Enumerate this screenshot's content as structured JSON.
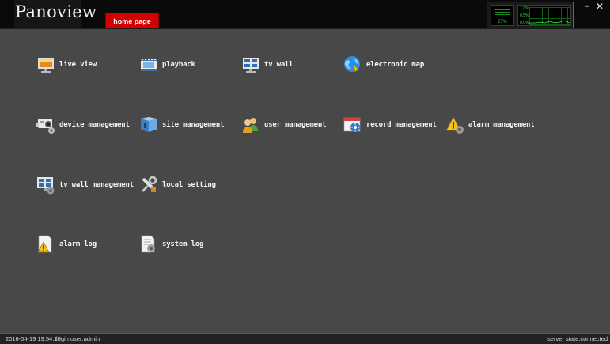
{
  "app": {
    "logo": "Panoview",
    "tab": "home page"
  },
  "monitor": {
    "cpu_text": "27%",
    "scale": [
      "1.0%",
      "0.5%",
      "0.0%"
    ]
  },
  "window": {
    "minimize": "–",
    "close": "✕"
  },
  "menu": [
    {
      "label": "live view",
      "icon": "live-view-icon"
    },
    {
      "label": "playback",
      "icon": "playback-icon"
    },
    {
      "label": "tv wall",
      "icon": "tv-wall-icon"
    },
    {
      "label": "electronic map",
      "icon": "electronic-map-icon"
    },
    {
      "label": "device management",
      "icon": "device-management-icon"
    },
    {
      "label": "site management",
      "icon": "site-management-icon"
    },
    {
      "label": "user management",
      "icon": "user-management-icon"
    },
    {
      "label": "record management",
      "icon": "record-management-icon"
    },
    {
      "label": "alarm management",
      "icon": "alarm-management-icon"
    },
    {
      "label": "tv wall management",
      "icon": "tv-wall-management-icon"
    },
    {
      "label": "local setting",
      "icon": "local-setting-icon"
    },
    {
      "label": "alarm log",
      "icon": "alarm-log-icon"
    },
    {
      "label": "system log",
      "icon": "system-log-icon"
    }
  ],
  "footer": {
    "datetime": "2016-04-19 19:54:17",
    "login": "login user:admin",
    "server": "server state:connected"
  }
}
